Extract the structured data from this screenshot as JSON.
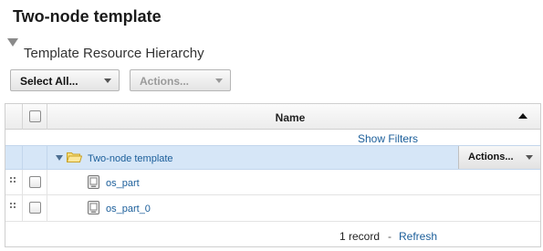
{
  "page": {
    "title": "Two-node template"
  },
  "section": {
    "title": "Template Resource Hierarchy"
  },
  "toolbar": {
    "select_all_label": "Select All...",
    "actions_label": "Actions..."
  },
  "grid": {
    "name_column_header": "Name",
    "sort_direction": "ascending",
    "show_filters_label": "Show Filters",
    "group_row": {
      "label": "Two-node template",
      "actions_label": "Actions...",
      "expanded": true
    },
    "rows": [
      {
        "label": "os_part"
      },
      {
        "label": "os_part_0"
      }
    ],
    "footer": {
      "record_count": "1 record",
      "separator": "-",
      "refresh_label": "Refresh"
    }
  },
  "colors": {
    "link": "#1b5e9a",
    "group_row_bg": "#d6e6f7",
    "folder": "#f2c94c"
  },
  "icons": [
    "collapse-triangle-icon",
    "dropdown-caret-icon",
    "sort-ascending-icon",
    "expand-triangle-icon",
    "folder-open-icon",
    "node-icon",
    "drag-handle-icon"
  ]
}
